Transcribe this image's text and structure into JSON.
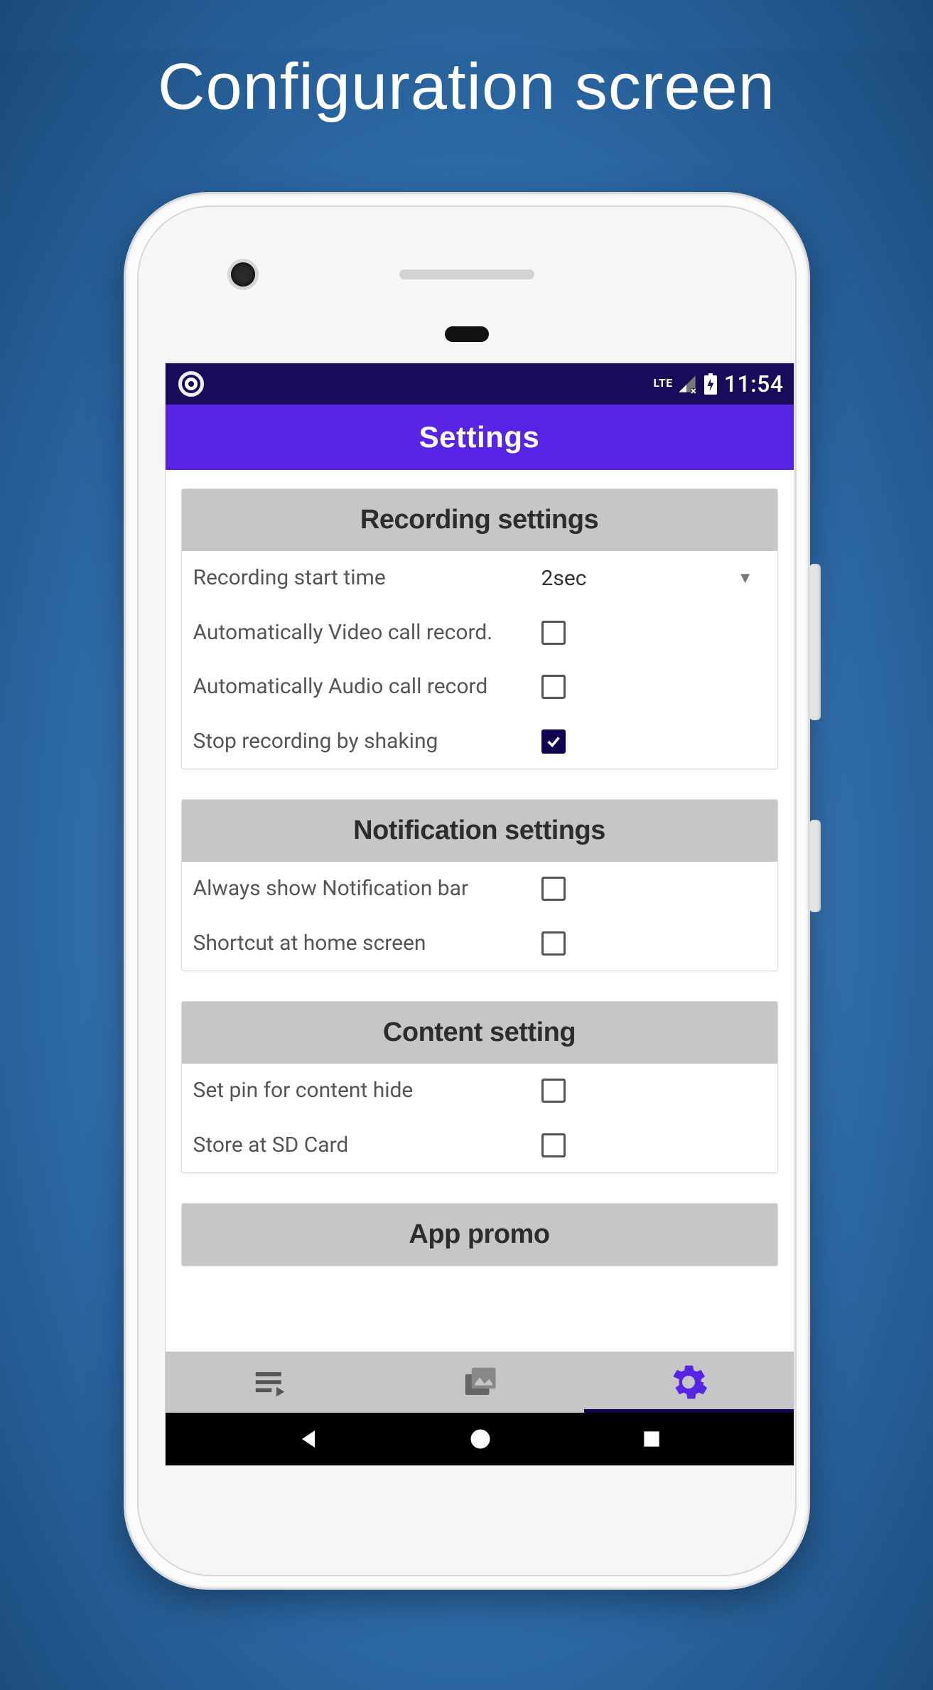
{
  "page_title": "Configuration screen",
  "status_bar": {
    "network_label": "LTE",
    "clock": "11:54"
  },
  "app_bar": {
    "title": "Settings"
  },
  "sections": {
    "recording": {
      "title": "Recording settings",
      "start_time_label": "Recording start time",
      "start_time_value": "2sec",
      "auto_video_label": "Automatically Video call record.",
      "auto_video_checked": false,
      "auto_audio_label": "Automatically Audio call record",
      "auto_audio_checked": false,
      "stop_shake_label": "Stop recording by shaking",
      "stop_shake_checked": true
    },
    "notification": {
      "title": "Notification settings",
      "show_bar_label": "Always show Notification bar",
      "show_bar_checked": false,
      "shortcut_label": "Shortcut at home screen",
      "shortcut_checked": false
    },
    "content_setting": {
      "title": "Content setting",
      "pin_label": "Set pin for content hide",
      "pin_checked": false,
      "sd_label": "Store at SD Card",
      "sd_checked": false
    },
    "app_promo": {
      "title": "App promo"
    }
  },
  "tabs": {
    "list_icon": "playlist-icon",
    "gallery_icon": "gallery-icon",
    "settings_icon": "gear-icon",
    "active_index": 2
  }
}
